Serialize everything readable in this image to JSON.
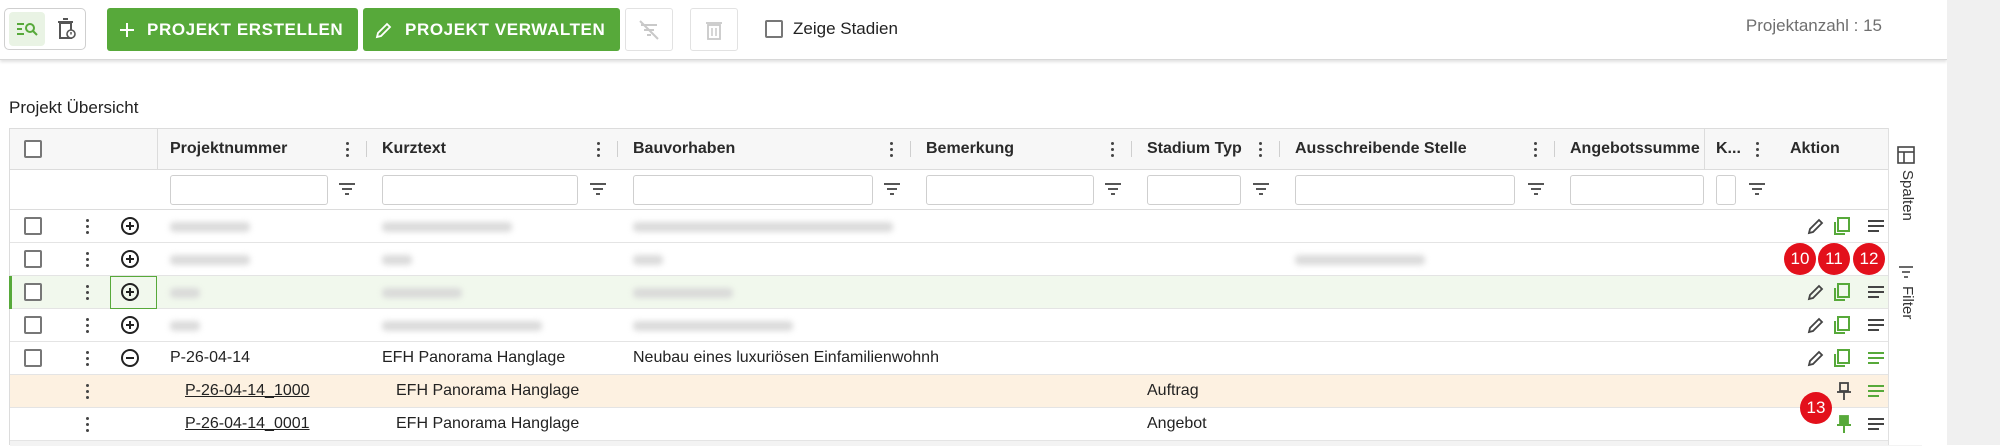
{
  "toolbar": {
    "create_label": "PROJEKT ERSTELLEN",
    "manage_label": "PROJEKT VERWALTEN",
    "show_stages_label": "Zeige Stadien",
    "project_count": "Projektanzahl : 15"
  },
  "panel": {
    "title": "Projekt Übersicht"
  },
  "columns": {
    "projektnummer": "Projektnummer",
    "kurztext": "Kurztext",
    "bauvorhaben": "Bauvorhaben",
    "bemerkung": "Bemerkung",
    "stadium_typ": "Stadium Typ",
    "ausschreibende_stelle": "Ausschreibende Stelle",
    "angebotssumme": "Angebotssumme",
    "k": "K...",
    "aktion": "Aktion"
  },
  "rows": {
    "expanded": {
      "projektnummer": "P-26-04-14",
      "kurztext": "EFH Panorama Hanglage",
      "bauvorhaben": "Neubau eines luxuriösen Einfamilienwohnh"
    },
    "child1": {
      "projektnummer": "P-26-04-14_1000",
      "kurztext": "EFH Panorama Hanglage",
      "stadium": "Auftrag"
    },
    "child2": {
      "projektnummer": "P-26-04-14_0001",
      "kurztext": "EFH Panorama Hanglage",
      "stadium": "Angebot"
    }
  },
  "badges": {
    "b10": "10",
    "b11": "11",
    "b12": "12",
    "b13": "13"
  },
  "side_panel": {
    "spalten": "Spalten",
    "filter": "Filter"
  },
  "colors": {
    "accent": "#57a93a",
    "badge": "#e3101b",
    "child_highlight": "#fdf1e1",
    "selected_row": "#f1f8ed"
  }
}
